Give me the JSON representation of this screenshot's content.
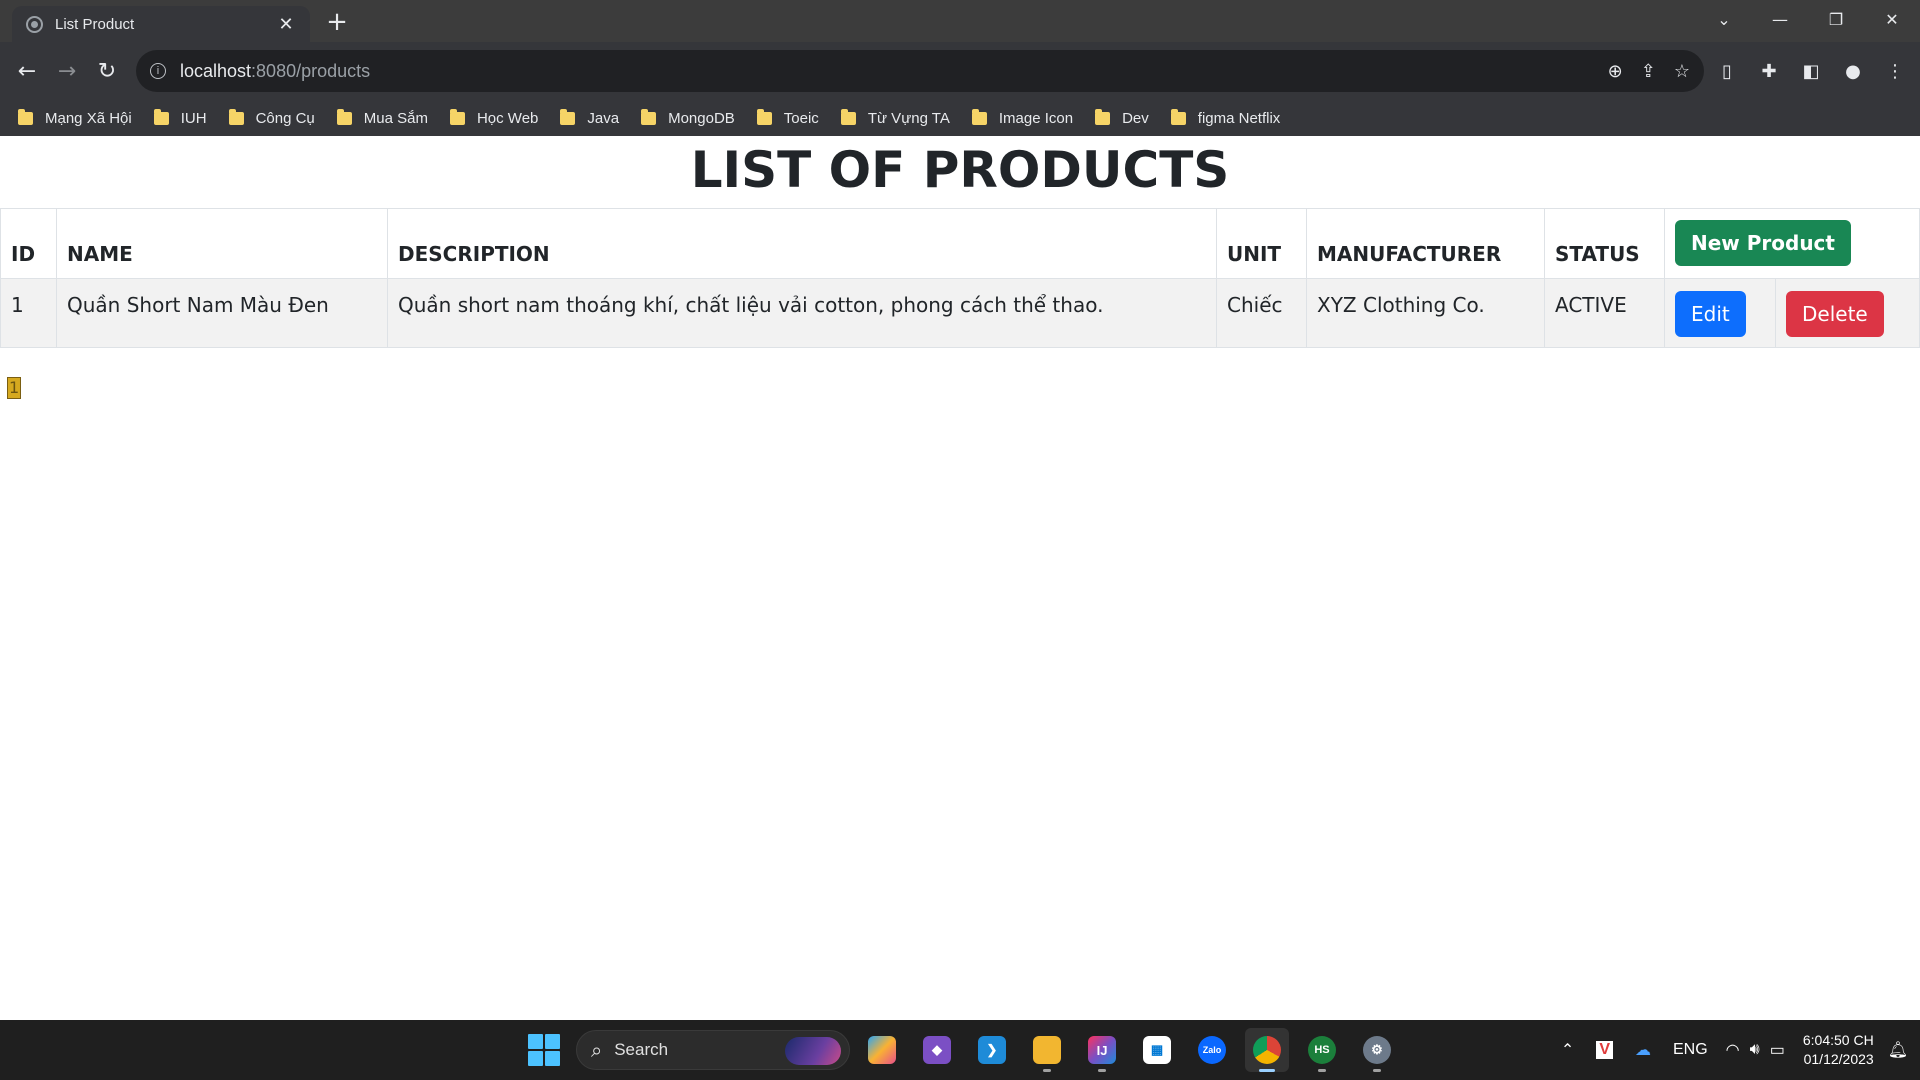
{
  "browser": {
    "tab_title": "List Product",
    "tab_close": "✕",
    "new_tab": "+",
    "url_host": "localhost",
    "url_path": ":8080/products",
    "bookmarks": [
      "Mạng Xã Hội",
      "IUH",
      "Công Cụ",
      "Mua Sắm",
      "Học Web",
      "Java",
      "MongoDB",
      "Toeic",
      "Từ Vựng TA",
      "Image Icon",
      "Dev",
      "figma Netflix"
    ]
  },
  "page": {
    "title": "LIST OF PRODUCTS",
    "columns": [
      "ID",
      "NAME",
      "DESCRIPTION",
      "UNIT",
      "MANUFACTURER",
      "STATUS"
    ],
    "new_button": "New Product",
    "rows": [
      {
        "id": "1",
        "name": "Quần Short Nam Màu Đen",
        "description": "Quần short nam thoáng khí, chất liệu vải cotton, phong cách thể thao.",
        "unit": "Chiếc",
        "manufacturer": "XYZ Clothing Co.",
        "status": "ACTIVE",
        "edit": "Edit",
        "delete": "Delete"
      }
    ],
    "pagination": "1"
  },
  "taskbar": {
    "search_label": "Search",
    "language": "ENG",
    "time": "6:04:50 CH",
    "date": "01/12/2023"
  },
  "colors": {
    "success": "#198754",
    "primary": "#0d6efd",
    "danger": "#dc3545",
    "chrome_dark": "#35363a"
  }
}
